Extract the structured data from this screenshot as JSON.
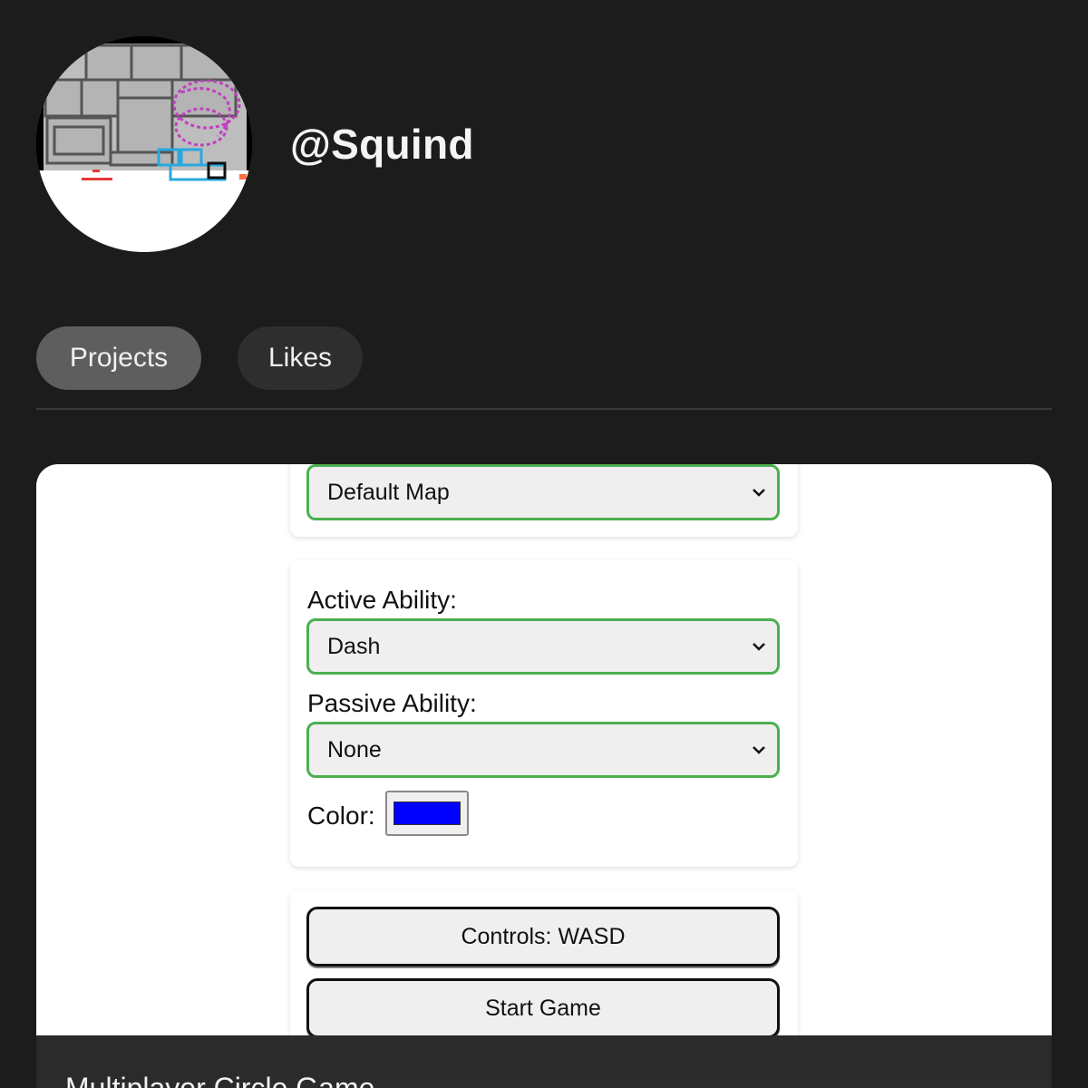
{
  "profile": {
    "username": "@Squind",
    "avatar_icon": "pixel-art-avatar"
  },
  "tabs": [
    {
      "label": "Projects",
      "active": true
    },
    {
      "label": "Likes",
      "active": false
    }
  ],
  "project": {
    "title": "Multiplayer Circle Game",
    "map_select": {
      "value": "Default Map"
    },
    "active_ability": {
      "label": "Active Ability:",
      "value": "Dash"
    },
    "passive_ability": {
      "label": "Passive Ability:",
      "value": "None"
    },
    "color": {
      "label": "Color:",
      "value": "#0000ff"
    },
    "controls_button": "Controls: WASD",
    "start_button": "Start Game"
  },
  "colors": {
    "background": "#1c1c1c",
    "accent_green": "#4caf50",
    "tab_active": "#5e5e5e",
    "tab_inactive": "#2e2e2e"
  }
}
